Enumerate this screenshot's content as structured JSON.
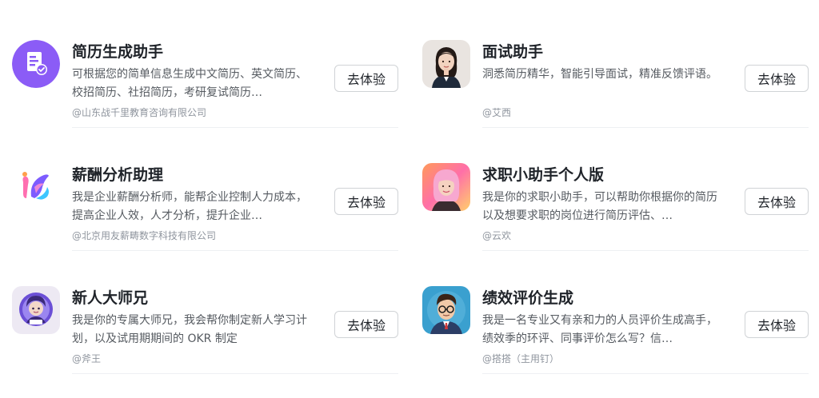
{
  "cards": [
    {
      "title": "简历生成助手",
      "desc": "可根据您的简单信息生成中文简历、英文简历、校招简历、社招简历，考研复试简历…",
      "org": "@山东战千里教育咨询有限公司",
      "button": "去体验",
      "icon": "resume-doc-check-icon",
      "accent": "#8b5cf6"
    },
    {
      "title": "面试助手",
      "desc": "洞悉简历精华，智能引导面试，精准反馈评语。",
      "org": "@艾西",
      "button": "去体验",
      "icon": "woman-avatar",
      "accent": "#1f2a3a"
    },
    {
      "title": "薪酬分析助理",
      "desc": "我是企业薪酬分析师，能帮企业控制人力成本，提高企业人效，人才分析，提升企业…",
      "org": "@北京用友薪畴数字科技有限公司",
      "button": "去体验",
      "icon": "colorful-logo-icon",
      "accent": "#6b7cff"
    },
    {
      "title": "求职小助手个人版",
      "desc": "我是你的求职小助手，可以帮助你根据你的简历以及想要求职的岗位进行简历评估、…",
      "org": "@云欢",
      "button": "去体验",
      "icon": "pink-hair-avatar",
      "accent": "#ff9ac8"
    },
    {
      "title": "新人大师兄",
      "desc": "我是你的专属大师兄，我会帮你制定新人学习计划，以及试用期期间的 OKR 制定",
      "org": "@斧王",
      "button": "去体验",
      "icon": "cartoon-boy-avatar",
      "accent": "#7b5cff"
    },
    {
      "title": "绩效评价生成",
      "desc": "我是一名专业又有亲和力的人员评价生成高手，绩效季的环评、同事评价怎么写？信…",
      "org": "@搭搭（主用钉）",
      "button": "去体验",
      "icon": "glasses-man-avatar",
      "accent": "#2f8fbf"
    }
  ]
}
